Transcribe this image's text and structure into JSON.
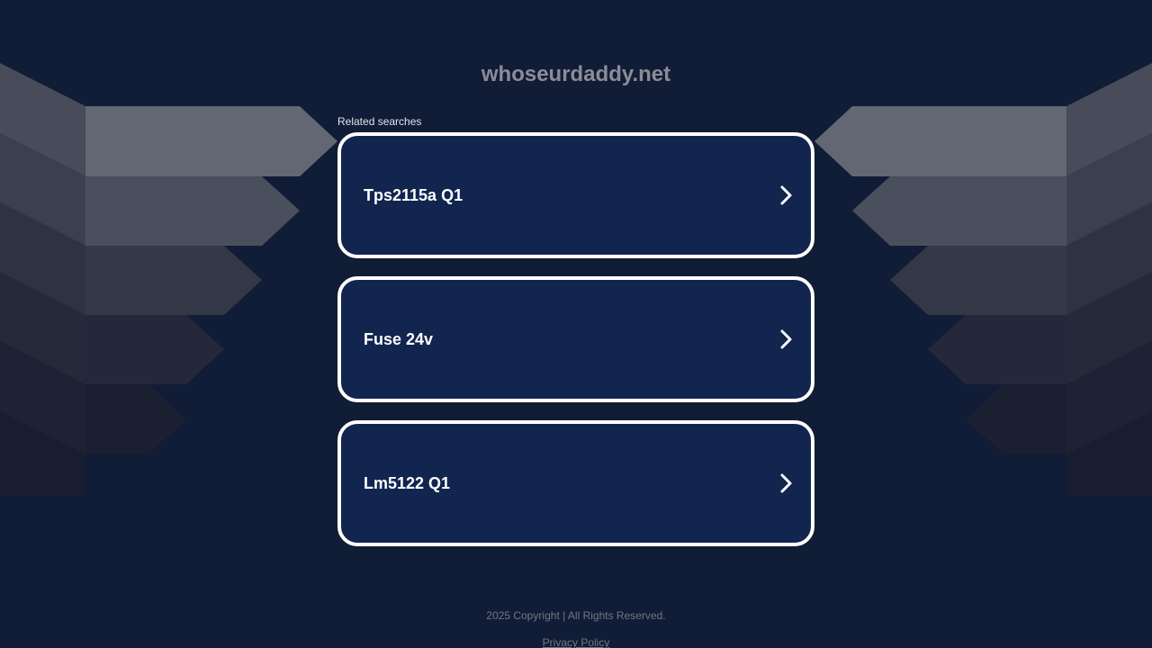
{
  "header": {
    "domain": "whoseurdaddy.net"
  },
  "related": {
    "label": "Related searches",
    "items": [
      {
        "label": "Tps2115a Q1"
      },
      {
        "label": "Fuse 24v"
      },
      {
        "label": "Lm5122 Q1"
      }
    ]
  },
  "footer": {
    "copyright": "2025 Copyright | All Rights Reserved.",
    "privacy_label": "Privacy Policy"
  },
  "colors": {
    "background": "#111c37",
    "card_fill": "#11254f",
    "card_border": "#ffffff",
    "title_text": "#8a8d96"
  },
  "icons": {
    "result_arrow": "chevron-right-icon"
  }
}
